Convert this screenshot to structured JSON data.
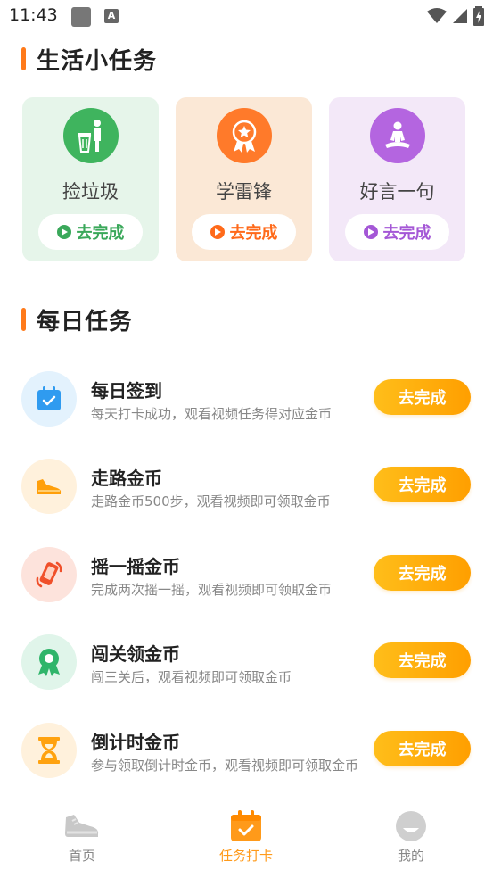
{
  "status_bar": {
    "time": "11:43",
    "app_badge": "A"
  },
  "life_section": {
    "title": "生活小任务",
    "cards": [
      {
        "name": "捡垃圾",
        "button": "去完成",
        "icon": "trash-person-icon",
        "bg": "#e6f5ea",
        "icon_bg": "#3fb45e",
        "accent": "#3aa85a"
      },
      {
        "name": "学雷锋",
        "button": "去完成",
        "icon": "medal-icon",
        "bg": "#fbe8d6",
        "icon_bg": "#ff7a2a",
        "accent": "#ff6a1a"
      },
      {
        "name": "好言一句",
        "button": "去完成",
        "icon": "meditation-icon",
        "bg": "#f3e8f8",
        "icon_bg": "#b465e0",
        "accent": "#a457d6"
      }
    ]
  },
  "daily_section": {
    "title": "每日任务",
    "tasks": [
      {
        "title": "每日签到",
        "desc": "每天打卡成功，观看视频任务得对应金币",
        "button": "去完成",
        "icon": "calendar-check-icon",
        "icon_bg": "#e3f2fd"
      },
      {
        "title": "走路金币",
        "desc": "走路金币500步，观看视频即可领取金币",
        "button": "去完成",
        "icon": "shoe-icon",
        "icon_bg": "#fff1dc"
      },
      {
        "title": "摇一摇金币",
        "desc": "完成两次摇一摇，观看视频即可领取金币",
        "button": "去完成",
        "icon": "shake-phone-icon",
        "icon_bg": "#fde3dc"
      },
      {
        "title": "闯关领金币",
        "desc": "闯三关后，观看视频即可领取金币",
        "button": "去完成",
        "icon": "badge-icon",
        "icon_bg": "#e0f5ea"
      },
      {
        "title": "倒计时金币",
        "desc": "参与领取倒计时金币，观看视频即可领取金币",
        "button": "去完成",
        "icon": "hourglass-icon",
        "icon_bg": "#fff1dc"
      }
    ]
  },
  "bottom_nav": {
    "items": [
      {
        "label": "首页",
        "icon": "sneaker-icon"
      },
      {
        "label": "任务打卡",
        "icon": "calendar-check-icon",
        "active": true
      },
      {
        "label": "我的",
        "icon": "profile-icon"
      }
    ]
  },
  "colors": {
    "accent_orange": "#ff9a1a",
    "button_gradient_start": "#ffbe1a",
    "button_gradient_end": "#ff9f00"
  }
}
